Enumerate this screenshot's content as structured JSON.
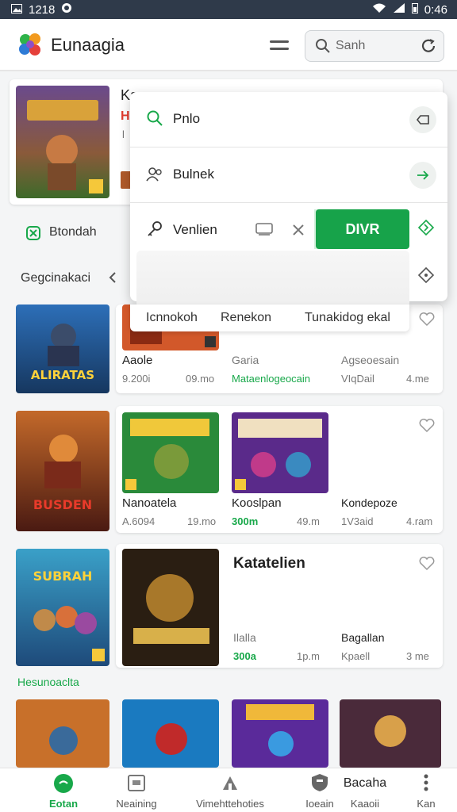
{
  "status_bar": {
    "time": "1218",
    "battery": "0:46"
  },
  "header": {
    "title": "Eunaagia",
    "search_placeholder": "Sanh"
  },
  "featured": {
    "title_partial": "Ka",
    "badge_text": "H",
    "side_letter": "l"
  },
  "filter_chip": {
    "label": "Btondah"
  },
  "section": {
    "label": "Gegcinakaci",
    "bottom_label": "Hesunoaclta"
  },
  "dropdown": {
    "rows": [
      {
        "label": "Pnlo"
      },
      {
        "label": "Bulnek"
      },
      {
        "label": "Venlien"
      }
    ],
    "cta_label": "DIVR",
    "tabs": [
      "Icnnokoh",
      "Renekon",
      "Tunakidog ekal"
    ]
  },
  "rows": [
    {
      "tiles": [
        {
          "title": "Aaole",
          "meta_left": "9.200i",
          "meta_right": "09.mo"
        },
        {
          "title": "Garia",
          "meta_left": "Mataenlogeocain",
          "meta_right": ""
        },
        {
          "title": "Agseoesain",
          "meta_left": "VIqDail",
          "meta_right": "4.me"
        }
      ],
      "hero_text": "ALIRATAS"
    },
    {
      "tiles": [
        {
          "title": "Nanoatela",
          "meta_left": "A.6094",
          "meta_right": "19.mo"
        },
        {
          "title": "Kooslpan",
          "meta_left": "300m",
          "meta_right": "49.m"
        },
        {
          "title": "Kondepoze",
          "meta_left": "1V3aid",
          "meta_right": "4.ram"
        }
      ],
      "hero_text": "BUSDEN"
    },
    {
      "tiles": [
        {
          "title": "Katatelien",
          "meta_left": "Ilalla",
          "meta_right": ""
        },
        {
          "title": "",
          "meta_left": "300a",
          "meta_right": "1p.m"
        },
        {
          "title": "Bagallan",
          "meta_left": "Kpaell",
          "meta_right": "3 me"
        }
      ],
      "hero_text": "SUBRAH"
    }
  ],
  "bottom_nav": [
    {
      "label": "Eotan",
      "icon": "home-icon",
      "active": true
    },
    {
      "label": "Neaining",
      "icon": "calendar-icon",
      "active": false
    },
    {
      "label": "Vimehttehoties",
      "icon": "chart-icon",
      "active": false
    },
    {
      "label": "Ioeain",
      "icon": "shield-icon",
      "active": false
    },
    {
      "label": "Bacaha",
      "sublabel": "Kaaoii",
      "icon": "",
      "active": false
    },
    {
      "label": "Kan",
      "icon": "more-icon",
      "active": false
    }
  ],
  "colors": {
    "accent": "#18a84a",
    "statusbar": "#2f3a4a"
  }
}
